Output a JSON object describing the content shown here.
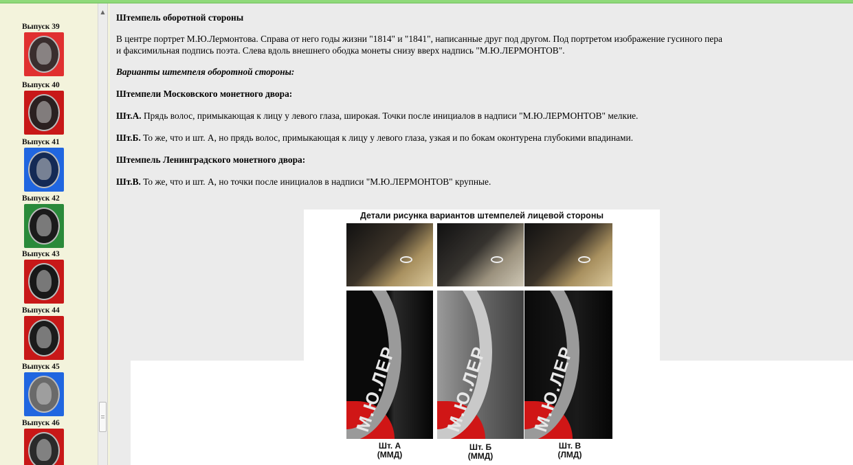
{
  "sidebar": {
    "issues": [
      {
        "label": "Выпуск 39",
        "bg": "#e03030",
        "coin": "#3a2e2e"
      },
      {
        "label": "Выпуск 40",
        "bg": "#c81818",
        "coin": "#2a2020"
      },
      {
        "label": "Выпуск 41",
        "bg": "#2066e0",
        "coin": "#142a55"
      },
      {
        "label": "Выпуск 42",
        "bg": "#2a8a3a",
        "coin": "#1b1b1b"
      },
      {
        "label": "Выпуск 43",
        "bg": "#c81818",
        "coin": "#181818"
      },
      {
        "label": "Выпуск 44",
        "bg": "#c81818",
        "coin": "#1b1b1b"
      },
      {
        "label": "Выпуск 45",
        "bg": "#2066e0",
        "coin": "#6a6a6a"
      },
      {
        "label": "Выпуск 46",
        "bg": "#c81818",
        "coin": "#2a2a2a"
      }
    ]
  },
  "article": {
    "reverse_heading": "Штемпель оборотной стороны",
    "reverse_desc_1": "В центре портрет М.Ю.Лермонтова. Справа от него годы жизни \"1814\" и \"1841\", написанные друг под другом. Под портретом изображение гусиного пера",
    "reverse_desc_2": "и факсимильная подпись поэта. Слева вдоль внешнего ободка монеты снизу вверх надпись \"М.Ю.ЛЕРМОНТОВ\".",
    "variants_heading": "Варианты штемпеля оборотной стороны:",
    "moscow_heading": "Штемпели Московского монетного двора:",
    "sht_a_label": "Шт.А.",
    "sht_a_text": " Прядь волос, примыкающая к лицу у левого глаза, широкая. Точки после инициалов в надписи \"М.Ю.ЛЕРМОНТОВ\" мелкие.",
    "sht_b_label": "Шт.Б.",
    "sht_b_text": " То же, что и шт. А, но прядь волос, примыкающая к лицу у левого глаза, узкая и по бокам оконтурена глубокими впадинами.",
    "leningrad_heading": "Штемпель Ленинградского монетного двора:",
    "sht_v_label": "Шт.В.",
    "sht_v_text": " То же, что и шт. А, но точки после инициалов в надписи \"М.Ю.ЛЕРМОНТОВ\" крупные."
  },
  "figure": {
    "caption": "Детали рисунка вариантов штемпелей лицевой стороны",
    "rim_text": "М.Ю.ЛЕР",
    "labels": [
      {
        "name": "Шт. А",
        "mint": "(ММД)"
      },
      {
        "name": "Шт. Б",
        "mint": "(ММД)"
      },
      {
        "name": "Шт. В",
        "mint": "(ЛМД)"
      }
    ]
  },
  "colors": {
    "topbar": "#8fd97a",
    "sidebar_bg": "#f3f3dc",
    "content_bg": "#ebebeb"
  }
}
